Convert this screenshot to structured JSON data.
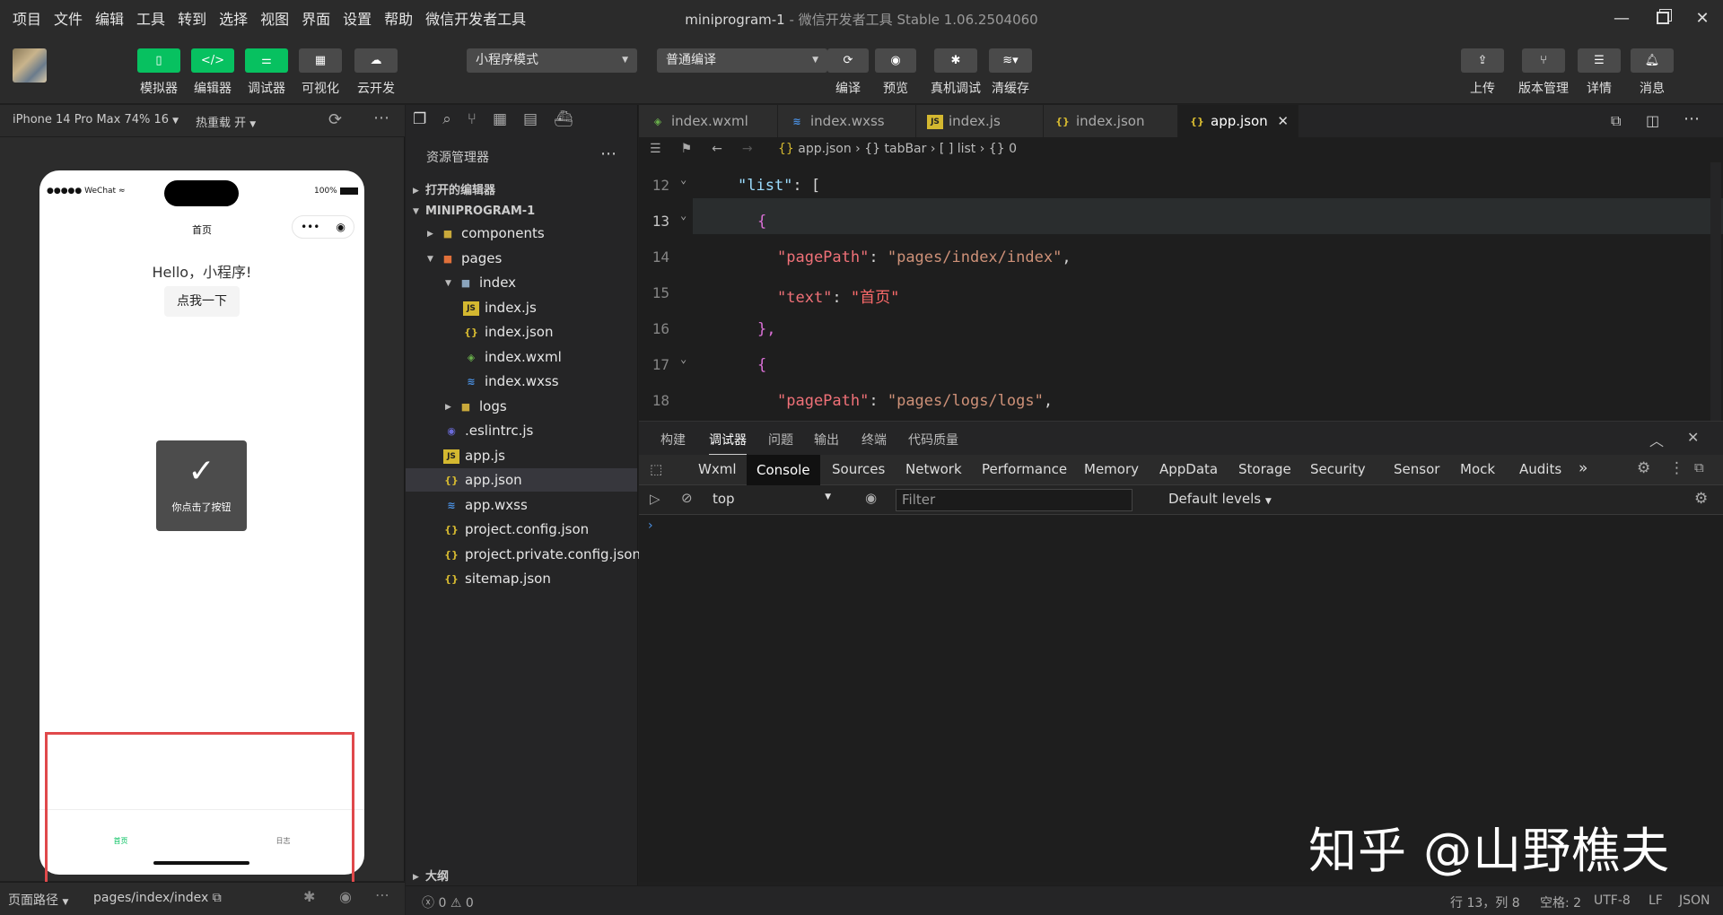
{
  "menu": {
    "items": [
      "项目",
      "文件",
      "编辑",
      "工具",
      "转到",
      "选择",
      "视图",
      "界面",
      "设置",
      "帮助",
      "微信开发者工具"
    ],
    "title_project": "miniprogram-1",
    "title_rest": " - 微信开发者工具 Stable 1.06.2504060"
  },
  "toolbar": {
    "simulator": "模拟器",
    "editor": "编辑器",
    "debugger": "调试器",
    "visual": "可视化",
    "cloud": "云开发",
    "mode": "小程序模式",
    "compile_mode": "普通编译",
    "compile": "编译",
    "preview": "预览",
    "realdebug": "真机调试",
    "clearcache": "清缓存",
    "upload": "上传",
    "version": "版本管理",
    "details": "详情",
    "messages": "消息"
  },
  "sim": {
    "device": "iPhone 14 Pro Max 74% 16",
    "hotreload": "热重载 开",
    "carrier": "WeChat",
    "battery": "100%",
    "nav_title": "首页",
    "hello": "Hello，小程序!",
    "button": "点我一下",
    "toast": "你点击了按钮",
    "tab_home": "首页",
    "tab_logs": "日志",
    "route_label": "页面路径",
    "route": "pages/index/index"
  },
  "explorer": {
    "title": "资源管理器",
    "open_editors": "打开的编辑器",
    "root": "MINIPROGRAM-1",
    "outline": "大纲",
    "items": [
      {
        "name": "components",
        "type": "folder"
      },
      {
        "name": "pages",
        "type": "folder"
      },
      {
        "name": "index",
        "type": "folder"
      },
      {
        "name": "index.js",
        "type": "js"
      },
      {
        "name": "index.json",
        "type": "json"
      },
      {
        "name": "index.wxml",
        "type": "wxml"
      },
      {
        "name": "index.wxss",
        "type": "wxss"
      },
      {
        "name": "logs",
        "type": "folder"
      },
      {
        "name": ".eslintrc.js",
        "type": "eslint"
      },
      {
        "name": "app.js",
        "type": "js"
      },
      {
        "name": "app.json",
        "type": "json"
      },
      {
        "name": "app.wxss",
        "type": "wxss"
      },
      {
        "name": "project.config.json",
        "type": "json"
      },
      {
        "name": "project.private.config.json",
        "type": "json"
      },
      {
        "name": "sitemap.json",
        "type": "json"
      }
    ]
  },
  "tabs": [
    "index.wxml",
    "index.wxss",
    "index.js",
    "index.json",
    "app.json"
  ],
  "breadcrumb": [
    "app.json",
    "tabBar",
    "list",
    "0"
  ],
  "code": {
    "lines": [
      "12",
      "13",
      "14",
      "15",
      "16",
      "17",
      "18"
    ],
    "l12_key": "\"list\"",
    "l12_rest": ": [",
    "l13": "{",
    "l14_key": "\"pagePath\"",
    "l14_val": "\"pages/index/index\"",
    "l15_key": "\"text\"",
    "l15_val": "\"首页\"",
    "l16": "},",
    "l17": "{",
    "l18_key": "\"pagePath\"",
    "l18_val": "\"pages/logs/logs\""
  },
  "panel": {
    "tabs": [
      "构建",
      "调试器",
      "问题",
      "输出",
      "终端",
      "代码质量"
    ],
    "devtabs": [
      "Wxml",
      "Console",
      "Sources",
      "Network",
      "Performance",
      "Memory",
      "AppData",
      "Storage",
      "Security",
      "Sensor",
      "Mock",
      "Audits"
    ],
    "context": "top",
    "filter_placeholder": "Filter",
    "levels": "Default levels"
  },
  "status": {
    "errors": "0",
    "warnings": "0",
    "position": "行 13，列 8",
    "spaces": "空格: 2",
    "encoding": "UTF-8",
    "eol": "LF",
    "lang": "JSON"
  },
  "watermark": "知乎 @山野樵夫"
}
